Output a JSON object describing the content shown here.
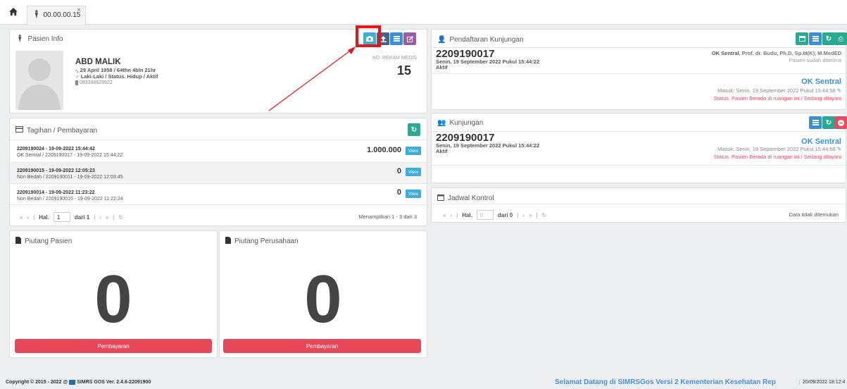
{
  "tab": {
    "label": "00.00.00.15",
    "close": "×"
  },
  "pasien": {
    "title": "Pasien Info",
    "name": "ABD MALIK",
    "dob": "-, 29 April 1958 / 64thn 4bln 21hr",
    "gender": "♂ Laki-Laki / Status. Hidup / Aktif",
    "phone": "083398629922",
    "rm_label": "NO. REKAM MEDIS",
    "rm_value": "15"
  },
  "tagihan": {
    "title": "Tagihan / Pembayaran",
    "rows": [
      {
        "id": "2209190024 - 19-09-2022 15:44:42",
        "desc": "OK Sentral / 2209190017 - 19-09-2022 15:44:22",
        "amount": "1.000.000",
        "view": "View"
      },
      {
        "id": "2209190015 - 19-09-2022 12:05:23",
        "desc": "Non Bedah / 2209190011 - 19-09-2022 12:03:45",
        "amount": "0",
        "view": "View"
      },
      {
        "id": "2209190014 - 19-09-2022 11:23:22",
        "desc": "Non Bedah / 2209190010 - 19-09-2022 11:22:24",
        "amount": "0",
        "view": "View"
      }
    ],
    "hal": "Hal.",
    "page": "1",
    "dari": "dari 1",
    "info": "Menampilkan 1 - 3 dari 3"
  },
  "piutang_pasien": {
    "title": "Piutang Pasien",
    "value": "0",
    "button": "Pembayaran"
  },
  "piutang_perusahaan": {
    "title": "Piutang Perusahaan",
    "value": "0",
    "button": "Pembayaran"
  },
  "pendaftaran": {
    "title": "Pendaftaran Kunjungan",
    "no": "2209190017",
    "date": "Senin, 19 September 2022 Pukul 15:44:22",
    "status": "Aktif",
    "ruang_bold": "OK Sentral",
    "dokter": ", Prof. dr. Budu, Ph.D, Sp.M(K), M.MedED",
    "diterima": "Pasien sudah diterima",
    "ruangan": "OK Sentral",
    "masuk": "Masuk: Senin, 19 September 2022 Pukul 15:44:58",
    "status_red": "Status. Pasien Berada di ruangan ini / Sedang dilayani"
  },
  "kunjungan": {
    "title": "Kunjungan",
    "no": "2209190017",
    "date": "Senin, 19 September 2022 Pukul 15:44:22",
    "status": "Aktif",
    "ruangan": "OK Sentral",
    "masuk": "Masuk: Senin, 19 September 2022 Pukul 15:44:58",
    "status_red": "Status. Pasien Berada di ruangan ini / Sedang dilayani"
  },
  "jadwal": {
    "title": "Jadwal Kontrol",
    "hal": "Hal.",
    "page": "0",
    "dari": "dari 0",
    "empty": "Data tidak ditemukan"
  },
  "footer": {
    "copyright": "Copyright © 2015 - 2022 @",
    "app": "SIMRS GOS Ver. 2.4.6-22091900",
    "welcome": "Selamat Datang di SIMRSGos Versi 2 Kementerian Kesehatan Rep",
    "datetime": "20/09/2022 18:12:4"
  },
  "colors": {
    "accent": "#3a8fd9",
    "danger": "#e64759",
    "annotation": "#e5161b"
  }
}
